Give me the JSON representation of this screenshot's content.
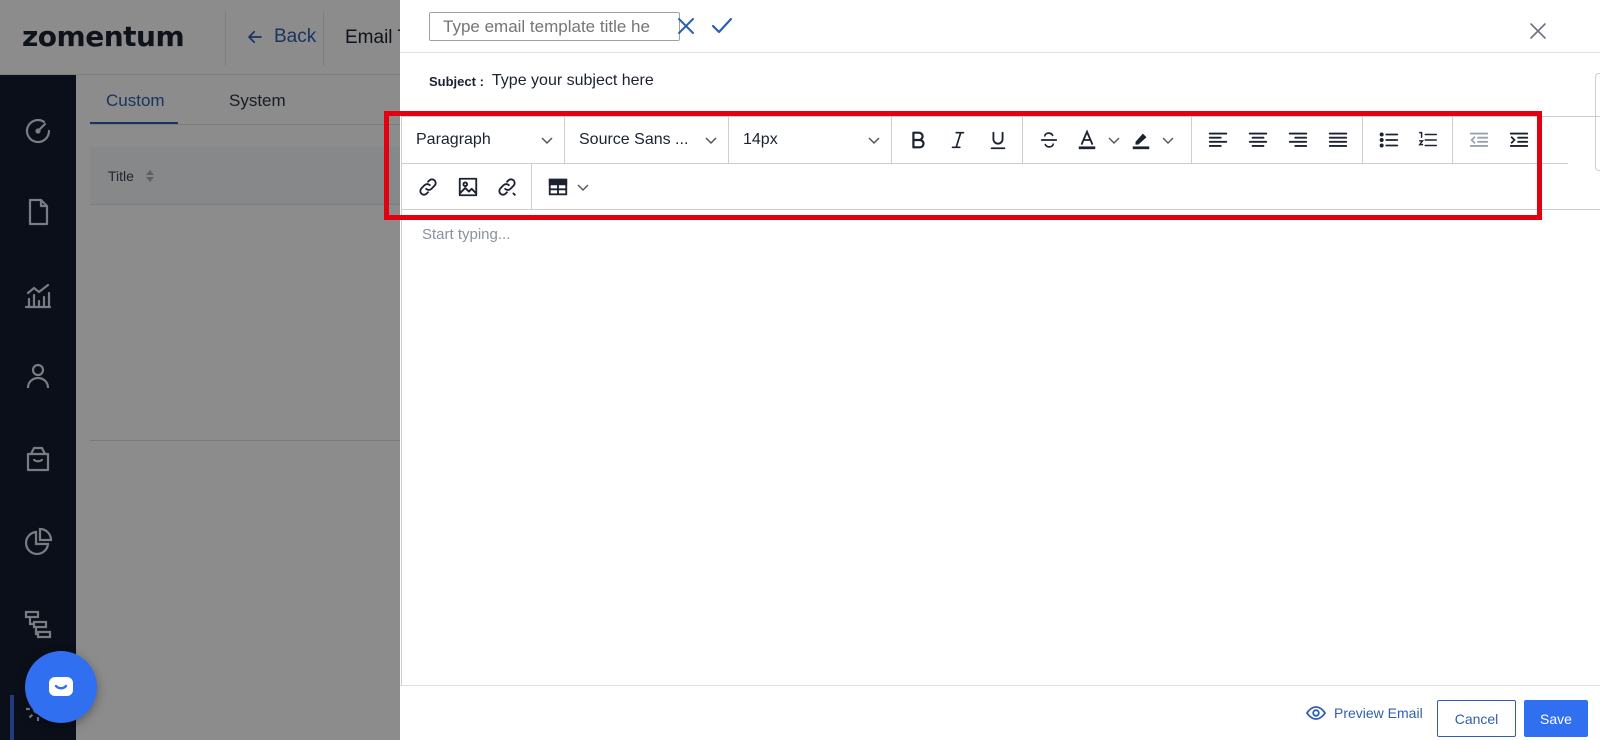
{
  "app": {
    "logo_text": "zomentum",
    "back_label": "Back",
    "breadcrumb": "Email T"
  },
  "sidebar": {
    "icons": [
      "dashboard-icon",
      "document-icon",
      "reports-icon",
      "user-icon",
      "store-icon",
      "pie-chart-icon",
      "hierarchy-icon",
      "settings-icon"
    ]
  },
  "list": {
    "tabs": [
      {
        "label": "Custom",
        "active": true
      },
      {
        "label": "System",
        "active": false
      }
    ],
    "column_title": "Title"
  },
  "drawer": {
    "title_input": {
      "value": "",
      "placeholder": "Type email template title he"
    },
    "subject_label": "Subject :",
    "subject_input": {
      "value": "",
      "placeholder": "Type your subject here"
    },
    "toolbar": {
      "block_format": "Paragraph",
      "font_family": "Source Sans ...",
      "font_size": "14px",
      "row1_buttons": [
        "bold-icon",
        "italic-icon",
        "underline-icon",
        "strikethrough-icon",
        "text-color-icon",
        "highlight-icon",
        "align-left-icon",
        "align-center-icon",
        "align-right-icon",
        "align-justify-icon",
        "bullet-list-icon",
        "numbered-list-icon",
        "outdent-icon",
        "indent-icon"
      ],
      "row2_buttons": [
        "link-icon",
        "image-icon",
        "unlink-icon",
        "table-icon"
      ]
    },
    "body_placeholder": "Start typing...",
    "footer": {
      "preview_label": "Preview Email",
      "cancel_label": "Cancel",
      "save_label": "Save"
    }
  },
  "colors": {
    "accent": "#2f6ff0",
    "link": "#2f5fb0",
    "sidebar_bg": "#141c2e",
    "highlight_box": "#e3000f"
  }
}
